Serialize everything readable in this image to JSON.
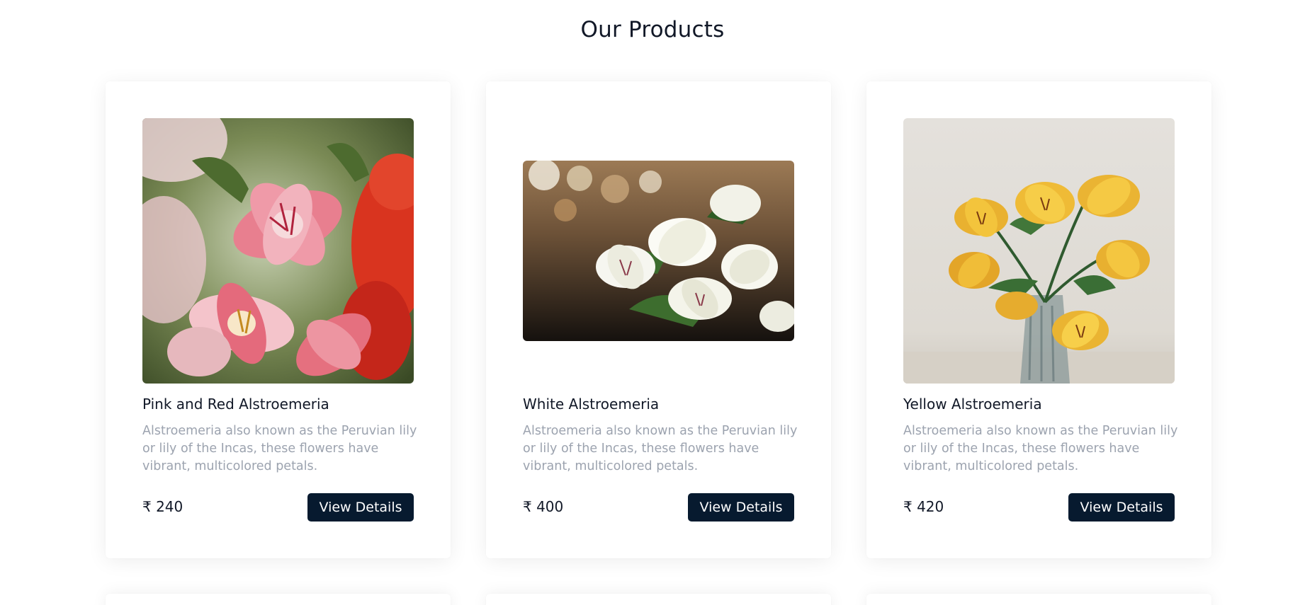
{
  "page": {
    "title": "Our Products"
  },
  "colors": {
    "button_bg": "#071a2f",
    "title_text": "#111827",
    "description_text": "#9ca3af"
  },
  "products": [
    {
      "name": "Pink and Red Alstroemeria",
      "description": "Alstroemeria also known as the Peruvian lily or lily of the Incas, these flowers have vibrant, multicolored petals.",
      "price": "₹ 240",
      "button_label": "View Details",
      "image": "pink-red-alstroemeria-photo"
    },
    {
      "name": "White Alstroemeria",
      "description": "Alstroemeria also known as the Peruvian lily or lily of the Incas, these flowers have vibrant, multicolored petals.",
      "price": "₹ 400",
      "button_label": "View Details",
      "image": "white-alstroemeria-photo"
    },
    {
      "name": "Yellow Alstroemeria",
      "description": "Alstroemeria also known as the Peruvian lily or lily of the Incas, these flowers have vibrant, multicolored petals.",
      "price": "₹ 420",
      "button_label": "View Details",
      "image": "yellow-alstroemeria-photo"
    }
  ]
}
